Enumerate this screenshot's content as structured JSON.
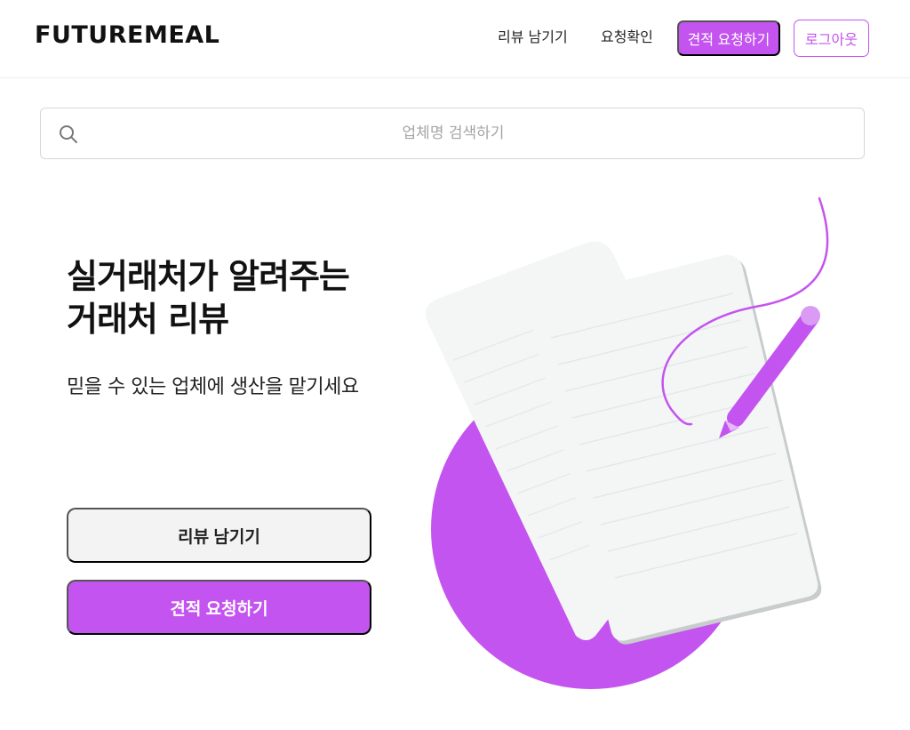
{
  "header": {
    "logo": "FUTUREMEAL",
    "nav": {
      "review": "리뷰 남기기",
      "check": "요청확인",
      "quote": "견적 요청하기",
      "logout": "로그아웃"
    }
  },
  "search": {
    "placeholder": "업체명 검색하기",
    "value": ""
  },
  "hero": {
    "title_line1": "실거래처가 알려주는",
    "title_line2": "거래처 리뷰",
    "subtitle": "믿을 수 있는 업체에 생산을 맡기세요",
    "review_button": "리뷰 남기기",
    "quote_button": "견적 요청하기"
  },
  "colors": {
    "accent": "#c454ef",
    "paper": "#f4f6f6",
    "text": "#111111"
  },
  "icons": {
    "search": "search-icon",
    "illustration": "documents-pen-illustration"
  }
}
